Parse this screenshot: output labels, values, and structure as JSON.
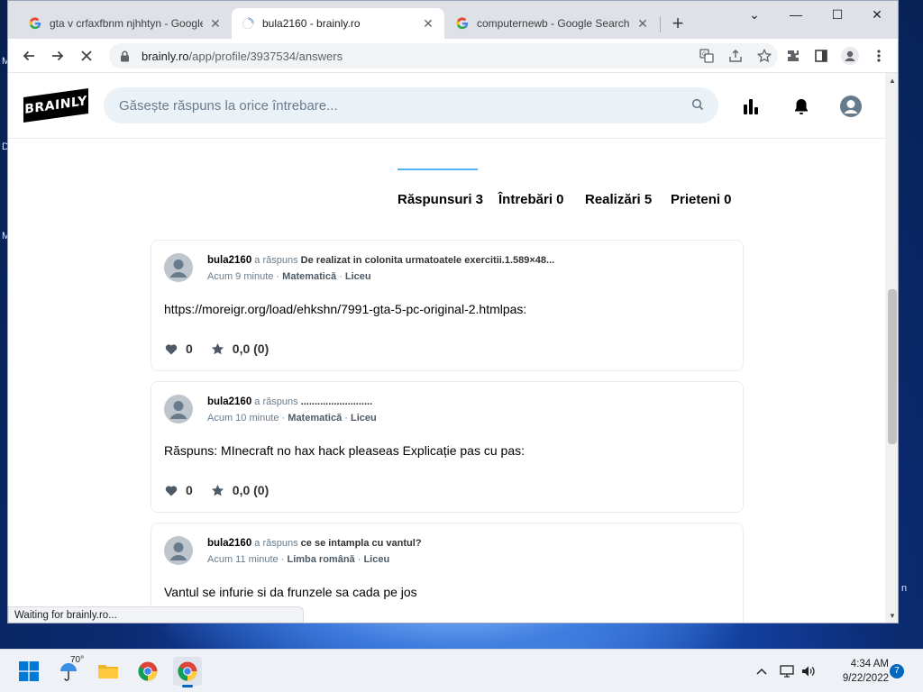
{
  "desktop": {
    "left_glyphs": [
      "M",
      "D",
      "M"
    ],
    "right_glyph": "n"
  },
  "browser": {
    "tabs": [
      {
        "title": "gta v crfaxfbnm njhhtyn - Google",
        "favicon": "google-icon",
        "active": false
      },
      {
        "title": "bula2160 - brainly.ro",
        "favicon": "loading-spinner-icon",
        "active": true
      },
      {
        "title": "computernewb - Google Search",
        "favicon": "google-icon",
        "active": false
      }
    ],
    "new_tab_label": "+",
    "window_controls": {
      "menu": "⌄",
      "minimize": "—",
      "maximize": "☐",
      "close": "✕"
    },
    "address": {
      "host": "brainly.ro",
      "path": "/app/profile/3937534/answers"
    },
    "status_text": "Waiting for brainly.ro..."
  },
  "site": {
    "logo_text": "BRAINLY",
    "search_placeholder": "Găsește răspuns la orice întrebare...",
    "profile_tabs": [
      {
        "label": "Răspunsuri 3",
        "active": true
      },
      {
        "label": "Întrebări 0",
        "active": false
      },
      {
        "label": "Realizări 5",
        "active": false
      },
      {
        "label": "Prieteni 0",
        "active": false
      }
    ],
    "answers": [
      {
        "user": "bula2160",
        "verb": "a răspuns",
        "question": "De realizat in colonita urmatoatele exercitii.1.589×48...",
        "time": "Acum 9 minute",
        "subject": "Matematică",
        "level": "Liceu",
        "body": "https://moreigr.org/load/ehkshn/7991-gta-5-pc-original-2.htmlpas:",
        "likes": "0",
        "rating": "0,0 (0)"
      },
      {
        "user": "bula2160",
        "verb": "a răspuns",
        "question": "..........................",
        "time": "Acum 10 minute",
        "subject": "Matematică",
        "level": "Liceu",
        "body": "Răspuns: MInecraft no hax hack pleaseas Explicație pas cu pas:",
        "likes": "0",
        "rating": "0,0 (0)"
      },
      {
        "user": "bula2160",
        "verb": "a răspuns",
        "question": "ce se intampla cu vantul?",
        "time": "Acum 11 minute",
        "subject": "Limba română",
        "level": "Liceu",
        "body": "Vantul se infurie si da frunzele sa cada pe jos",
        "likes": "",
        "rating": ""
      }
    ],
    "separator": "·"
  },
  "taskbar": {
    "weather_temp": "70°",
    "time": "4:34 AM",
    "date": "9/22/2022",
    "notification_count": "7"
  },
  "colors": {
    "accent_tab_indicator": "#4fb3f6",
    "search_bg": "#ebf2f7",
    "taskbar_accent": "#0067c0"
  }
}
